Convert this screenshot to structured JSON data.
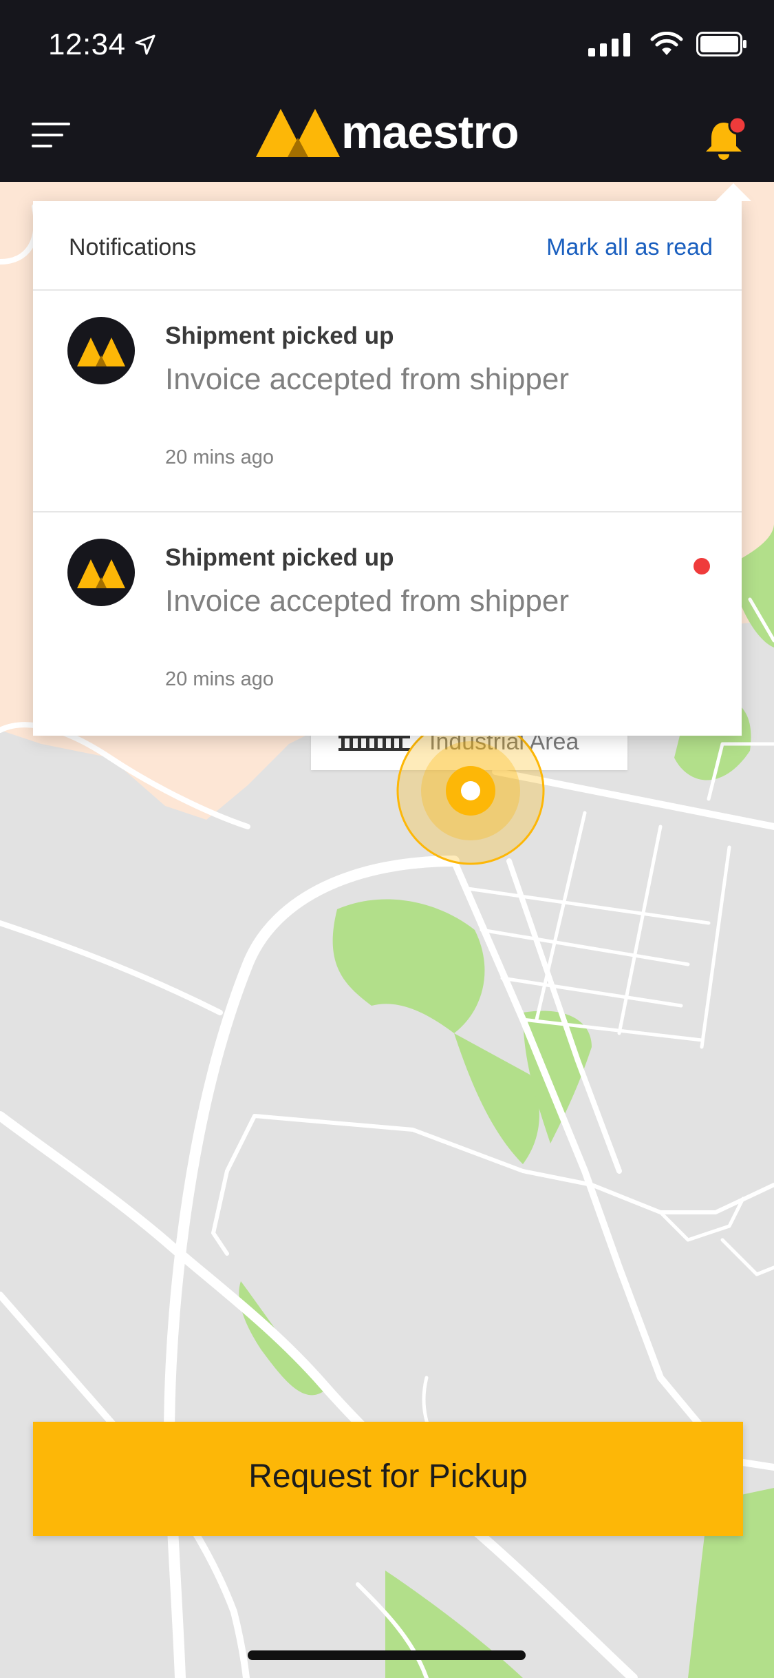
{
  "status_bar": {
    "time": "12:34"
  },
  "header": {
    "brand": "maestro",
    "notifications_has_unread": true
  },
  "notifications": {
    "title": "Notifications",
    "mark_all_label": "Mark all as read",
    "items": [
      {
        "heading": "Shipment picked up",
        "body": "Invoice accepted from shipper",
        "time": "20 mins ago",
        "unread": false
      },
      {
        "heading": "Shipment picked up",
        "body": "Invoice accepted from shipper",
        "time": "20 mins ago",
        "unread": true
      }
    ]
  },
  "map": {
    "place_label": "Industrial Area"
  },
  "cta": {
    "label": "Request for Pickup"
  },
  "colors": {
    "brand_yellow": "#fdb707",
    "header_bg": "#16161c",
    "link_blue": "#1a5fbf",
    "unread_red": "#ef3b3b"
  }
}
